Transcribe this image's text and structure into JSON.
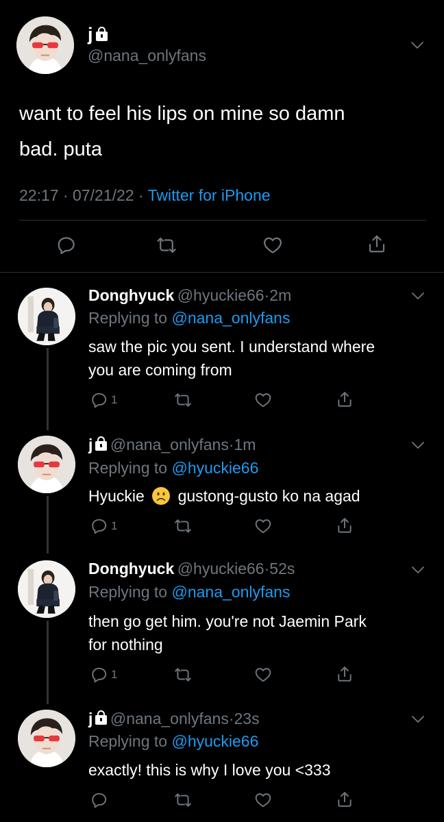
{
  "main_tweet": {
    "name": "j",
    "handle": "@nana_onlyfans",
    "text_line1": "want to feel his lips on mine so damn",
    "text_line2": "bad. puta",
    "time": "22:17",
    "date": "07/21/22",
    "source": "Twitter for iPhone"
  },
  "replies": [
    {
      "name": "Donghyuck",
      "handle": "@hyuckie66",
      "time": "2m",
      "replying_label": "Replying to",
      "replying_to": "@nana_onlyfans",
      "text_line1": "saw the pic you sent. I understand where",
      "text_line2": "you are coming from",
      "reply_count": "1"
    },
    {
      "name": "j",
      "handle": "@nana_onlyfans",
      "time": "1m",
      "replying_label": "Replying to",
      "replying_to": "@hyuckie66",
      "text_before_emoji": "Hyuckie",
      "text_after_emoji": "gustong-gusto ko na agad",
      "reply_count": "1"
    },
    {
      "name": "Donghyuck",
      "handle": "@hyuckie66",
      "time": "52s",
      "replying_label": "Replying to",
      "replying_to": "@nana_onlyfans",
      "text_line1": "then go get him. you're not Jaemin Park",
      "text_line2": "for nothing",
      "reply_count": "1"
    },
    {
      "name": "j",
      "handle": "@nana_onlyfans",
      "time": "23s",
      "replying_label": "Replying to",
      "replying_to": "@hyuckie66",
      "text_line1": "exactly! this is why I love you <333"
    }
  ],
  "icons": [
    "chevron-down-icon",
    "reply-icon",
    "retweet-icon",
    "like-icon",
    "share-icon",
    "lock-icon",
    "frowning-face-emoji"
  ],
  "colors": {
    "background": "#000000",
    "muted": "#6e767d",
    "link": "#1d9bf0",
    "divider": "#2f3336"
  }
}
